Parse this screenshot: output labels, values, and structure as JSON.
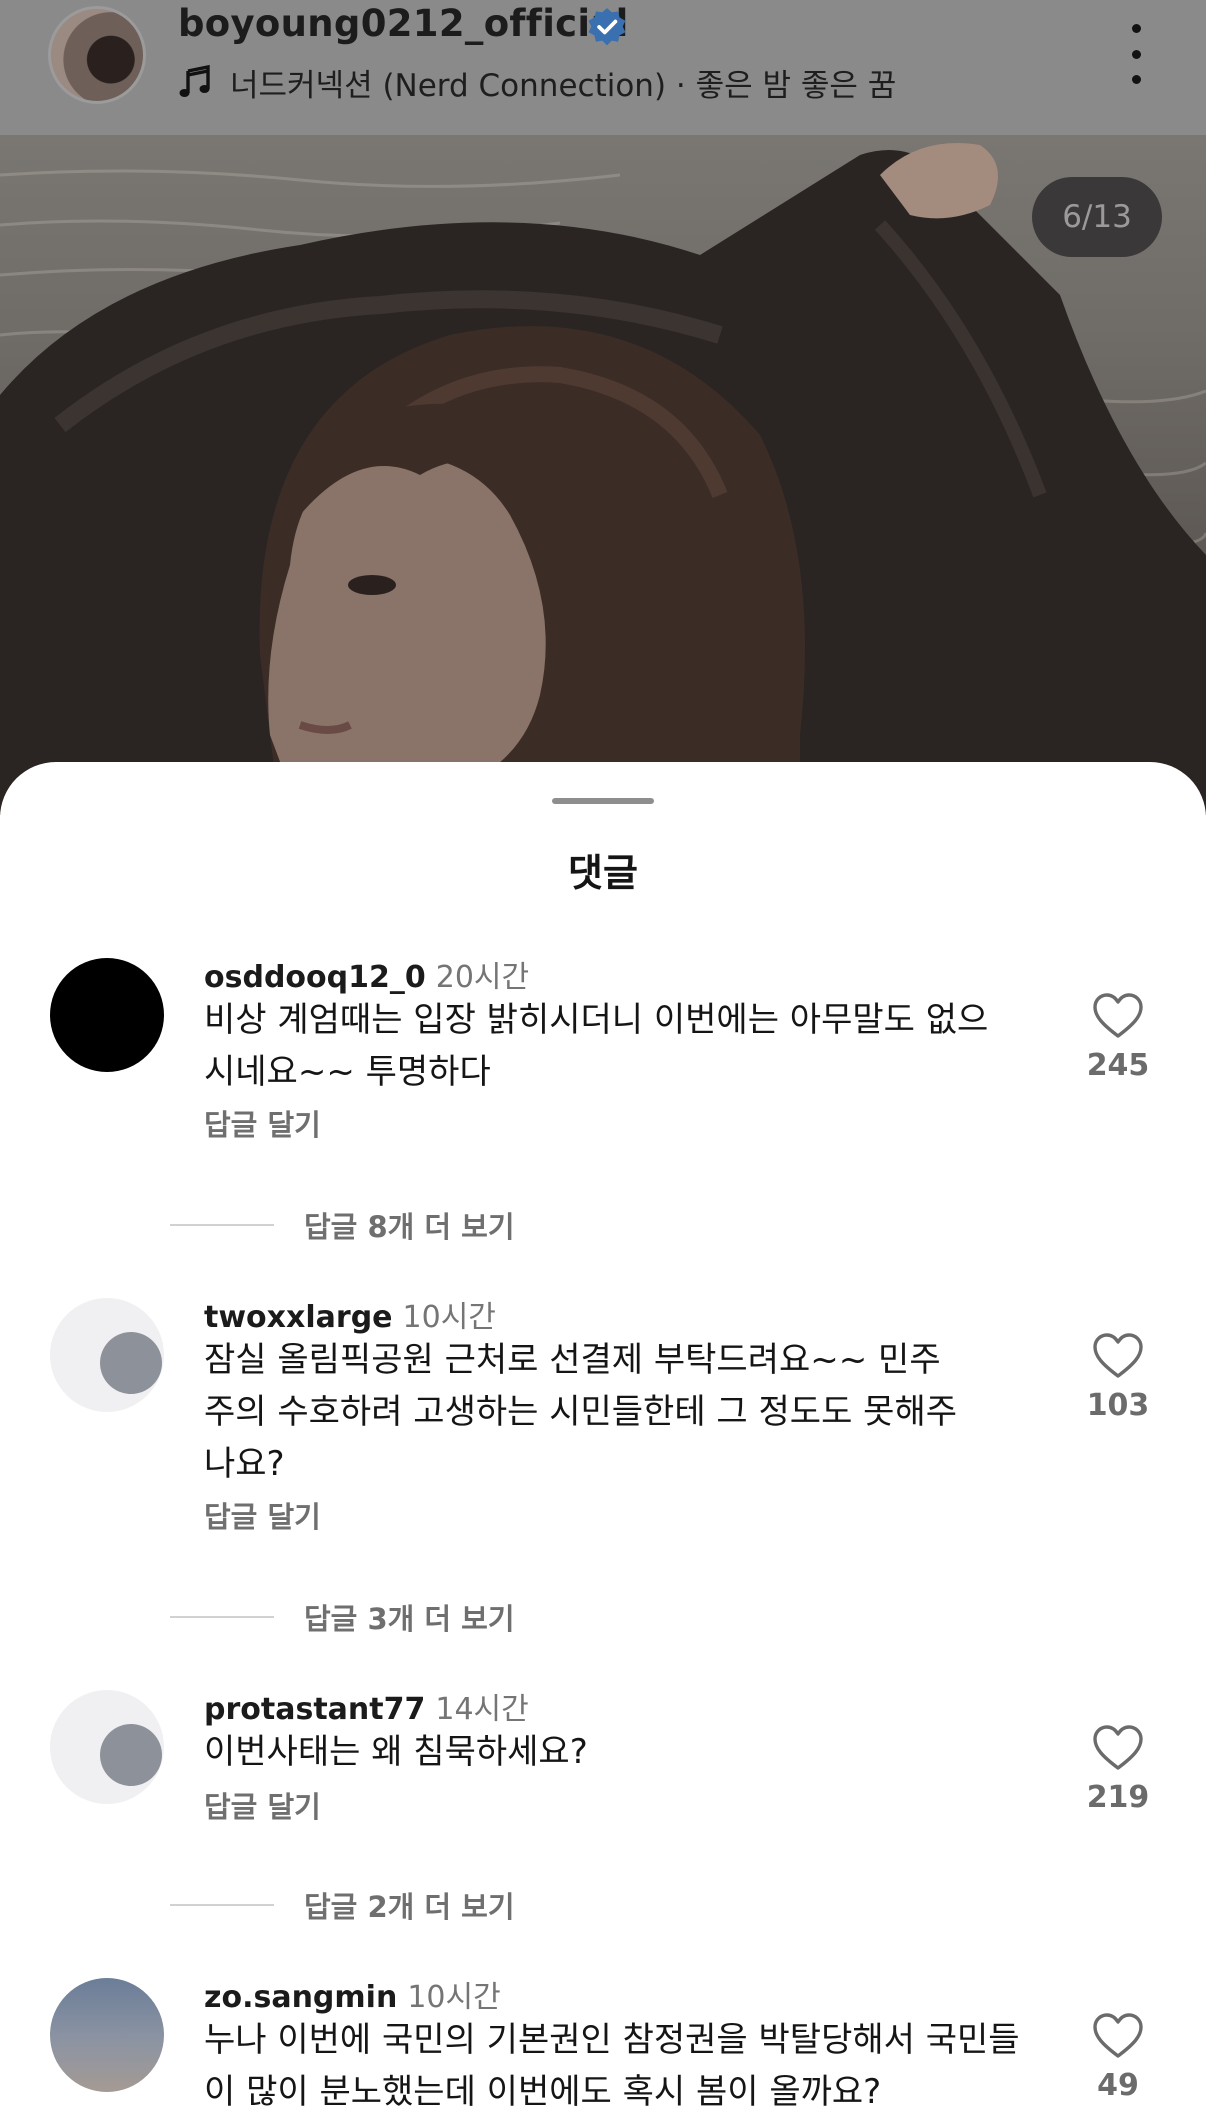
{
  "header": {
    "username": "boyoung0212_official",
    "music": "너드커넥션 (Nerd Connection) · 좋은 밤 좋은 꿈",
    "verified_icon": "verified-badge-icon",
    "more_icon": "more-vertical-icon"
  },
  "photo": {
    "counter": "6/13"
  },
  "sheet": {
    "title": "댓글"
  },
  "comments": [
    {
      "user": "osddooq12_0",
      "time": "20시간",
      "text": "비상 계엄때는 입장 밝히시더니 이번에는 아무말도 없으시네요~~ 투명하다",
      "reply": "답글 달기",
      "likes": "245",
      "view_replies": "답글 8개 더 보기"
    },
    {
      "user": "twoxxlarge",
      "time": "10시간",
      "text": "잠실 올림픽공원 근처로 선결제 부탁드려요~~ 민주주의 수호하려 고생하는 시민들한테 그 정도도 못해주나요?",
      "reply": "답글 달기",
      "likes": "103",
      "view_replies": "답글 3개 더 보기"
    },
    {
      "user": "protastant77",
      "time": "14시간",
      "text": "이번사태는 왜 침묵하세요?",
      "reply": "답글 달기",
      "likes": "219",
      "view_replies": "답글 2개 더 보기"
    },
    {
      "user": "zo.sangmin",
      "time": "10시간",
      "text": "누나 이번에 국민의 기본권인 참정권을 박탈당해서 국민들이 많이 분노했는데 이번에도 혹시 봄이 올까요?",
      "likes": "49"
    }
  ]
}
